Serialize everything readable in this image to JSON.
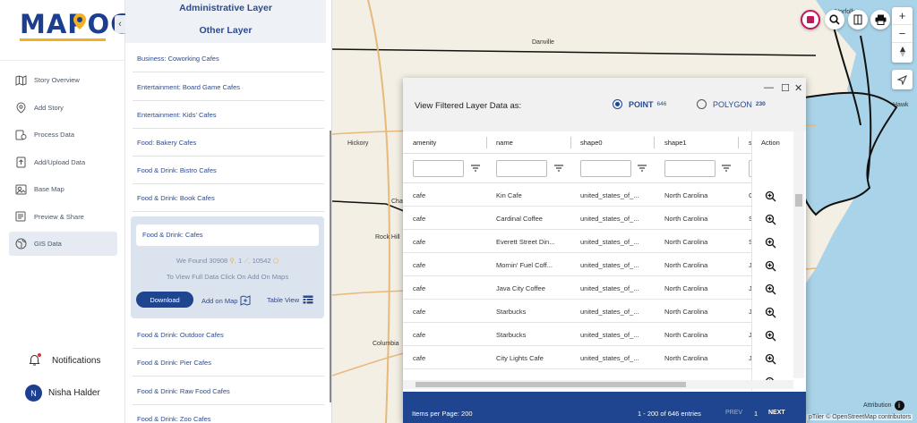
{
  "brand": {
    "logo": "MAPOG"
  },
  "nav": {
    "items": [
      {
        "label": "Story Overview",
        "icon": "map-icon"
      },
      {
        "label": "Add Story",
        "icon": "pin-icon"
      },
      {
        "label": "Process Data",
        "icon": "process-icon"
      },
      {
        "label": "Add/Upload Data",
        "icon": "upload-icon"
      },
      {
        "label": "Base Map",
        "icon": "basemap-icon"
      },
      {
        "label": "Preview & Share",
        "icon": "preview-icon"
      },
      {
        "label": "GIS Data",
        "icon": "globe-icon"
      }
    ],
    "active": "GIS Data",
    "notifications_label": "Notifications",
    "user_initial": "N",
    "user_name": "Nisha Halder"
  },
  "panel": {
    "admin_layer": "Administrative Layer",
    "other_layer": "Other Layer",
    "layers_top": [
      "Business: Coworking Cafes",
      "Entertainment: Board Game Cafes",
      "Entertainment: Kids' Cafes",
      "Food: Bakery Cafes",
      "Food & Drink: Bistro Cafes",
      "Food & Drink: Book Cafes"
    ],
    "selected": {
      "name": "Food & Drink: Cafes",
      "found_prefix": "We Found",
      "points": "30908",
      "lines": "1",
      "polygons": "10542",
      "tip": "To View Full Data Click On Add On Maps",
      "download": "Download",
      "add_on_map": "Add on Map",
      "table_view": "Table View"
    },
    "layers_bottom": [
      "Food & Drink: Outdoor Cafes",
      "Food & Drink: Pier Cafes",
      "Food & Drink: Raw Food Cafes",
      "Food & Drink: Zoo Cafes"
    ]
  },
  "map": {
    "places": [
      "Danville",
      "Hickory",
      "Cha",
      "Rock Hill",
      "Columbia",
      "Norfolk",
      "Hawk"
    ],
    "attribution": "Attribution",
    "credit": "pTiler © OpenStreetMap contributors"
  },
  "dialog": {
    "title": "View Filtered Layer Data as:",
    "point_label": "POINT",
    "point_count": "646",
    "polygon_label": "POLYGON",
    "polygon_count": "230",
    "selected_mode": "POINT",
    "columns": [
      "amenity",
      "name",
      "shape0",
      "shape1",
      "s",
      "Action"
    ],
    "rows": [
      {
        "amenity": "cafe",
        "name": "Kin Cafe",
        "shape0": "united_states_of_...",
        "shape1": "North Carolina",
        "s": "C"
      },
      {
        "amenity": "cafe",
        "name": "Cardinal Coffee",
        "shape0": "united_states_of_...",
        "shape1": "North Carolina",
        "s": "S"
      },
      {
        "amenity": "cafe",
        "name": "Everett Street Din...",
        "shape0": "united_states_of_...",
        "shape1": "North Carolina",
        "s": "S"
      },
      {
        "amenity": "cafe",
        "name": "Mornin' Fuel Coff...",
        "shape0": "united_states_of_...",
        "shape1": "North Carolina",
        "s": "Ja"
      },
      {
        "amenity": "cafe",
        "name": "Java City Coffee",
        "shape0": "united_states_of_...",
        "shape1": "North Carolina",
        "s": "Ja"
      },
      {
        "amenity": "cafe",
        "name": "Starbucks",
        "shape0": "united_states_of_...",
        "shape1": "North Carolina",
        "s": "Ja"
      },
      {
        "amenity": "cafe",
        "name": "Starbucks",
        "shape0": "united_states_of_...",
        "shape1": "North Carolina",
        "s": "Ja"
      },
      {
        "amenity": "cafe",
        "name": "City Lights Cafe",
        "shape0": "united_states_of_...",
        "shape1": "North Carolina",
        "s": "Ja"
      }
    ],
    "footer": {
      "per_page": "Items per Page: 200",
      "entries": "1 - 200 of 646 entries",
      "prev": "PREV",
      "page": "1",
      "next": "NEXT"
    }
  }
}
